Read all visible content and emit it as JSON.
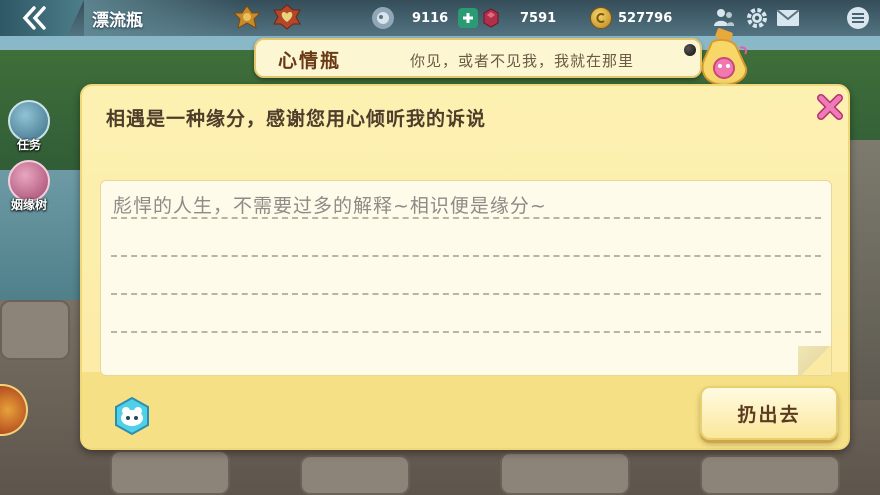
{
  "topbar": {
    "title": "漂流瓶",
    "gems": "9116",
    "rubies": "7591",
    "gold": "527796"
  },
  "side_menu": {
    "items": [
      {
        "label": "任务"
      },
      {
        "label": "姻缘树"
      }
    ]
  },
  "header_card": {
    "title": "心情瓶",
    "subtitle": "你见，或者不见我，我就在那里"
  },
  "dialog": {
    "heading": "相遇是一种缘分，感谢您用心倾听我的诉说",
    "message": "彪悍的人生，不需要过多的解释~相识便是缘分~",
    "throw_label": "扔出去"
  },
  "colors": {
    "dialog_bg": "#fdf1b2",
    "close_pink": "#e85aa0",
    "emoji_cyan": "#4fd0e8",
    "text_brown": "#4e3d2a"
  },
  "icons": [
    "back-chevron-icon",
    "rank-medal-icon",
    "heart-medal-icon",
    "gem-icon",
    "plus-icon",
    "ruby-icon",
    "gold-coin-icon",
    "friends-icon",
    "gear-icon",
    "mail-icon",
    "menu-icon",
    "close-icon",
    "emoji-icon",
    "bottle-icon"
  ]
}
